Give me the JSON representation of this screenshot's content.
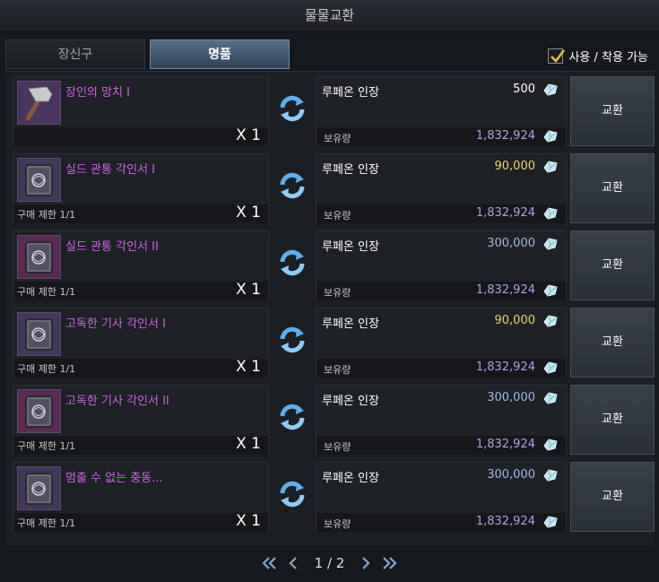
{
  "window": {
    "title": "물물교환"
  },
  "tabs": [
    {
      "label": "장신구",
      "active": false
    },
    {
      "label": "명품",
      "active": true
    }
  ],
  "filter": {
    "label": "사용 / 착용 가능",
    "checked": true
  },
  "exchange_label": "교환",
  "cost_name": "루페온 인장",
  "owned_label": "보유량",
  "rows": [
    {
      "item_name": "장인의 망치 I",
      "limit": "",
      "qty": "X 1",
      "cost": "500",
      "cost_color": "#ffffff",
      "owned": "1,832,924",
      "icon": "hammer-icon",
      "icon_bg": "#4a3560"
    },
    {
      "item_name": "실드 관통 각인서 I",
      "limit": "구매 제한 1/1",
      "qty": "X 1",
      "cost": "90,000",
      "cost_color": "#e6d56a",
      "owned": "1,832,924",
      "icon": "engraving-book-icon",
      "icon_bg": "#41385a"
    },
    {
      "item_name": "실드 관통 각인서 II",
      "limit": "구매 제한 1/1",
      "qty": "X 1",
      "cost": "300,000",
      "cost_color": "#9fb8e6",
      "owned": "1,832,924",
      "icon": "engraving-book-icon",
      "icon_bg": "#5a2a52"
    },
    {
      "item_name": "고독한 기사 각인서 I",
      "limit": "구매 제한 1/1",
      "qty": "X 1",
      "cost": "90,000",
      "cost_color": "#e6d56a",
      "owned": "1,832,924",
      "icon": "engraving-book-icon",
      "icon_bg": "#41385a"
    },
    {
      "item_name": "고독한 기사 각인서 II",
      "limit": "구매 제한 1/1",
      "qty": "X 1",
      "cost": "300,000",
      "cost_color": "#9fb8e6",
      "owned": "1,832,924",
      "icon": "engraving-book-icon",
      "icon_bg": "#5a2a52"
    },
    {
      "item_name": "멈출 수 없는 충동...",
      "limit": "구매 제한 1/1",
      "qty": "X 1",
      "cost": "300,000",
      "cost_color": "#9fb8e6",
      "owned": "1,832,924",
      "icon": "engraving-book-icon",
      "icon_bg": "#41385a"
    }
  ],
  "pagination": {
    "label": "1 / 2"
  }
}
